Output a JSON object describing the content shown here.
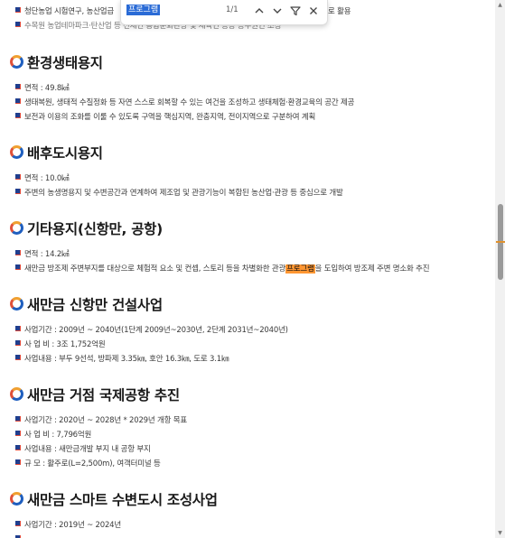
{
  "find_bar": {
    "query": "프로그램",
    "count": "1/1",
    "icons": [
      "chevron-up-icon",
      "chevron-down-icon",
      "filter-icon",
      "close-icon"
    ],
    "highlight_color": "#ff9632",
    "input_selection_color": "#2a6bd6"
  },
  "top_lines": [
    "청단농업 시험연구, 농산업급",
    "로 활용",
    "수목원 농업테마파크·탄산업 등 전체연 총합문화관광 및 체육연 공공 공무원연 조성"
  ],
  "sections": [
    {
      "title": "환경생태용지",
      "items": [
        "면적 : 49.8㎢",
        "생태복원, 생태적 수질정화 등 자연 스스로 회복할 수 있는 여건을 조성하고 생태체험·환경교육의 공간 제공",
        "보전과 이용의 조화를 이룰 수 있도록 구역을 핵심지역, 완충지역, 전이지역으로 구분하여 계획"
      ]
    },
    {
      "title": "배후도시용지",
      "items": [
        "면적 : 10.0㎢",
        "주변의 농생명용지 및 수변공간과 연계하여 제조업 및 관광기능이 복합된 농산업·관광 등 중심으로 개발"
      ]
    },
    {
      "title": "기타용지(신항만, 공항)",
      "items": [
        "면적 : 14.2㎢",
        "새만금 방조제 주변부지를 대상으로 체험적 요소 및 컨셉, 스토리 등을 차별화한 관광",
        "프로그램",
        "을 도입하여 방조제 주변 명소화 추진"
      ]
    },
    {
      "title": "새만금 신항만 건설사업",
      "items": [
        "사업기간 : 2009년 ~ 2040년(1단계 2009년~2030년, 2단계 2031년~2040년)",
        "사 업 비 : 3조 1,752억원",
        "사업내용 : 부두 9선석, 방파제 3.35㎞, 호안 16.3㎞, 도로 3.1㎞"
      ]
    },
    {
      "title": "새만금 거점 국제공항 추진",
      "items": [
        "사업기간 : 2020년 ~ 2028년 * 2029년 개항 목표",
        "사 업 비 : 7,796억원",
        "사업내용 : 새만금개발 부지 내 공항 부지",
        "규 모 : 활주로(L=2,500m), 여객터미널 등"
      ]
    },
    {
      "title": "새만금 스마트 수변도시 조성사업",
      "items": [
        "사업기간 : 2019년 ~ 2024년"
      ]
    }
  ]
}
